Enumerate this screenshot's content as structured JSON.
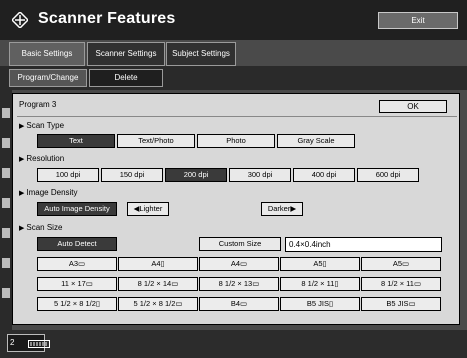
{
  "header": {
    "title": "Scanner Features",
    "exit_label": "Exit",
    "logo_icon": "diamond-cross-icon"
  },
  "tabs": [
    {
      "label": "Basic Settings",
      "active": true
    },
    {
      "label": "Scanner Settings",
      "active": false
    },
    {
      "label": "Subject Settings",
      "active": false
    }
  ],
  "actions": {
    "program_change": "Program/Change",
    "delete": "Delete"
  },
  "dialog": {
    "program_label": "Program 3",
    "ok_label": "OK",
    "scan_type": {
      "label": "Scan Type",
      "options": [
        "Text",
        "Text/Photo",
        "Photo",
        "Gray Scale"
      ],
      "selected": "Text"
    },
    "resolution": {
      "label": "Resolution",
      "options": [
        "100 dpi",
        "150 dpi",
        "200 dpi",
        "300 dpi",
        "400 dpi",
        "600 dpi"
      ],
      "selected": "200 dpi"
    },
    "image_density": {
      "label": "Image Density",
      "auto_label": "Auto Image Density",
      "lighter_label": "Lighter",
      "darker_label": "Darker"
    },
    "scan_size": {
      "label": "Scan Size",
      "auto_detect_label": "Auto Detect",
      "custom_size_label": "Custom Size",
      "custom_value": "0.4×0.4inch",
      "rows": [
        [
          "A3▭",
          "A4▯",
          "A4▭",
          "A5▯",
          "A5▭"
        ],
        [
          "11 × 17▭",
          "8 1/2 × 14▭",
          "8 1/2 × 13▭",
          "8 1/2 × 11▯",
          "8 1/2 × 11▭"
        ],
        [
          "5 1/2 × 8 1/2▯",
          "5 1/2 × 8 1/2▭",
          "B4▭",
          "B5 JIS▯",
          "B5 JIS▭"
        ]
      ]
    }
  },
  "status": {
    "counter": "2",
    "icon": "paper-tray-icon"
  }
}
